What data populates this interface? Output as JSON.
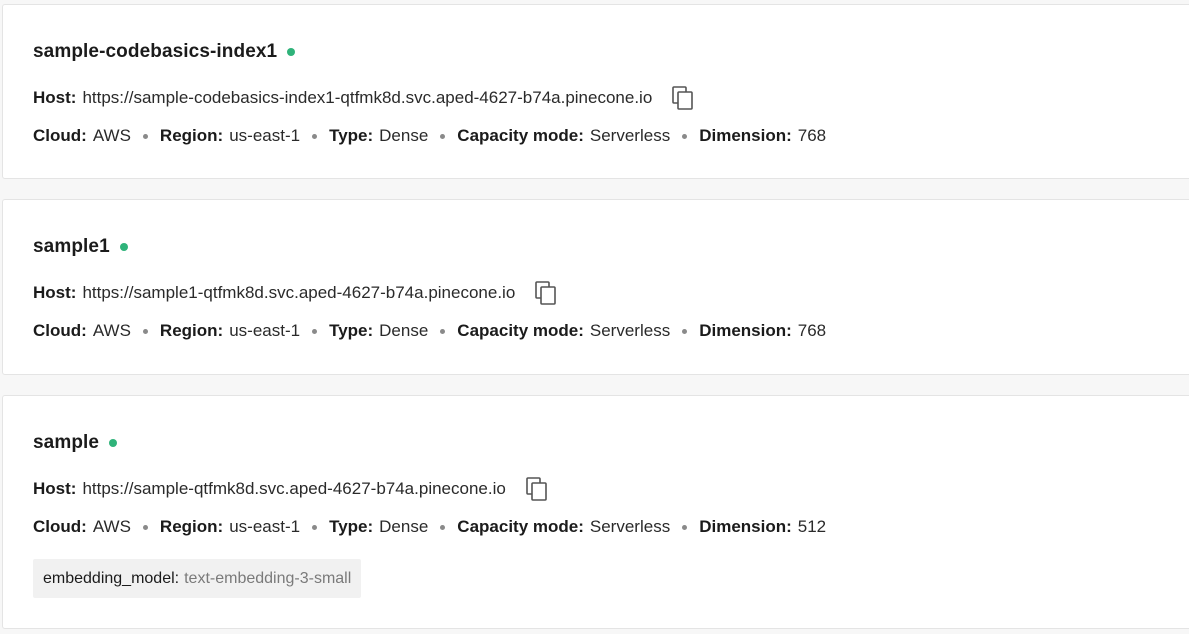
{
  "labels": {
    "host": "Host:",
    "cloud": "Cloud:",
    "region": "Region:",
    "type": "Type:",
    "capacity_mode": "Capacity mode:",
    "dimension": "Dimension:"
  },
  "status_color": "#2fb37a",
  "indexes": [
    {
      "name": "sample-codebasics-index1",
      "host": "https://sample-codebasics-index1-qtfmk8d.svc.aped-4627-b74a.pinecone.io",
      "cloud": "AWS",
      "region": "us-east-1",
      "type": "Dense",
      "capacity_mode": "Serverless",
      "dimension": "768"
    },
    {
      "name": "sample1",
      "host": "https://sample1-qtfmk8d.svc.aped-4627-b74a.pinecone.io",
      "cloud": "AWS",
      "region": "us-east-1",
      "type": "Dense",
      "capacity_mode": "Serverless",
      "dimension": "768"
    },
    {
      "name": "sample",
      "host": "https://sample-qtfmk8d.svc.aped-4627-b74a.pinecone.io",
      "cloud": "AWS",
      "region": "us-east-1",
      "type": "Dense",
      "capacity_mode": "Serverless",
      "dimension": "512",
      "tag": {
        "key": "embedding_model:",
        "value": "text-embedding-3-small"
      }
    }
  ],
  "icons": {
    "copy": "copy-icon",
    "status": "status-dot-icon"
  }
}
